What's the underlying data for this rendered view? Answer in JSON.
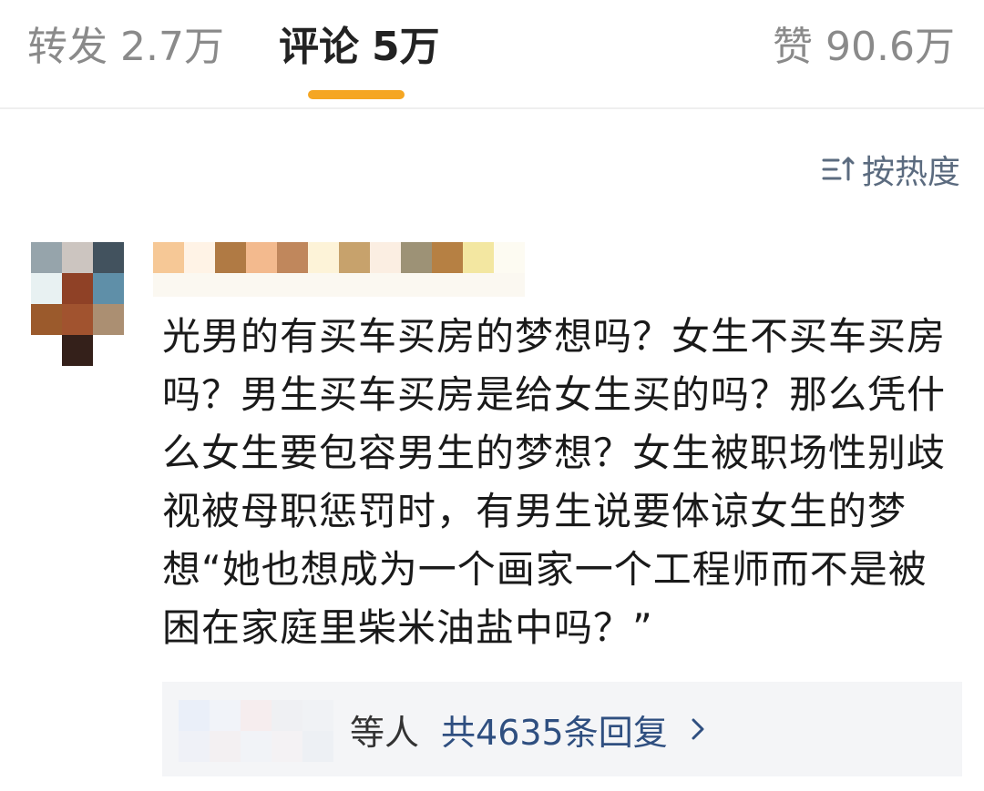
{
  "tabs": {
    "repost": {
      "label": "转发",
      "count": "2.7万"
    },
    "comments": {
      "label": "评论",
      "count": "5万"
    },
    "likes": {
      "label": "赞",
      "count": "90.6万"
    }
  },
  "active_tab": "comments",
  "accent_color": "#f5a623",
  "sort": {
    "label": "按热度",
    "icon": "sort-icon"
  },
  "comment": {
    "author_avatar": "pixelated-avatar",
    "author_name": "pixelated-username",
    "text": "光男的有买车买房的梦想吗？女生不买车买房吗？男生买车买房是给女生买的吗？那么凭什么女生要包容男生的梦想？女生被职场性别歧视被母职惩罚时，有男生说要体谅女生的梦想“她也想成为一个画家一个工程师而不是被困在家庭里柴米油盐中吗？”"
  },
  "replies": {
    "suffix": "等人",
    "count_label": "共4635条回复",
    "icon": "chevron-right-icon",
    "link_color": "#2f4f80"
  }
}
